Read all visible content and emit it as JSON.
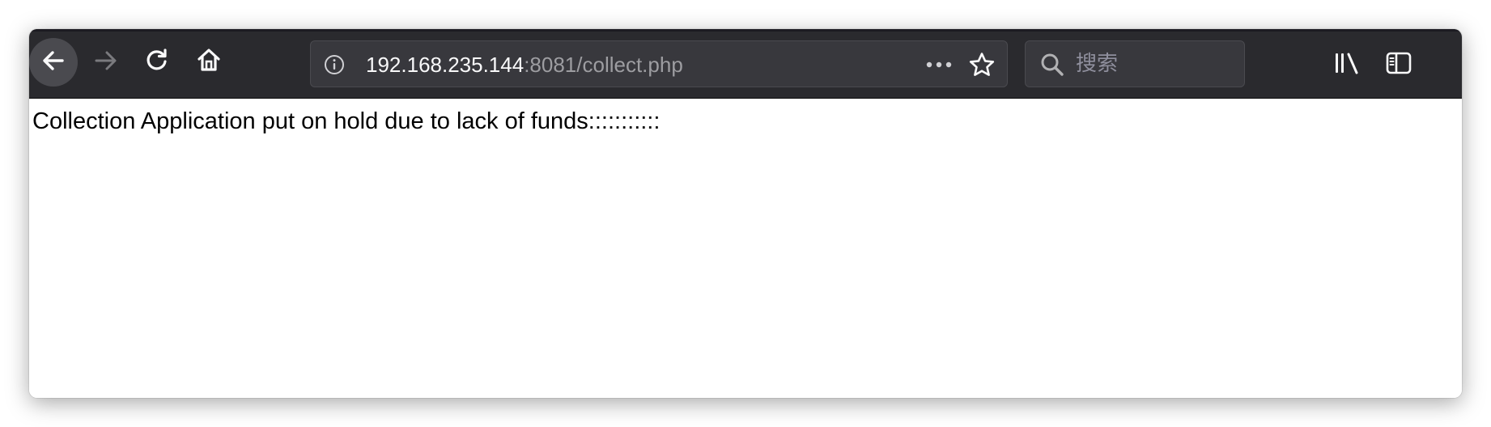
{
  "browser": {
    "url": {
      "host": "192.168.235.144",
      "rest": ":8081/collect.php"
    },
    "search": {
      "placeholder": "搜索"
    },
    "icons": {
      "back": "arrow-left-icon",
      "forward": "arrow-right-icon",
      "reload": "reload-icon",
      "home": "home-icon",
      "info": "info-icon",
      "more": "more-dots-icon",
      "bookmark": "star-icon",
      "search": "search-icon",
      "library": "library-icon",
      "sidebar": "sidebar-icon"
    },
    "colors": {
      "toolbar_bg": "#2a2a2e",
      "field_bg": "#38383d",
      "url_host": "#f9f9fa",
      "url_rest": "#9d9da1"
    }
  },
  "page": {
    "body_text": "Collection Application put on hold due to lack of funds:::::::::::"
  }
}
